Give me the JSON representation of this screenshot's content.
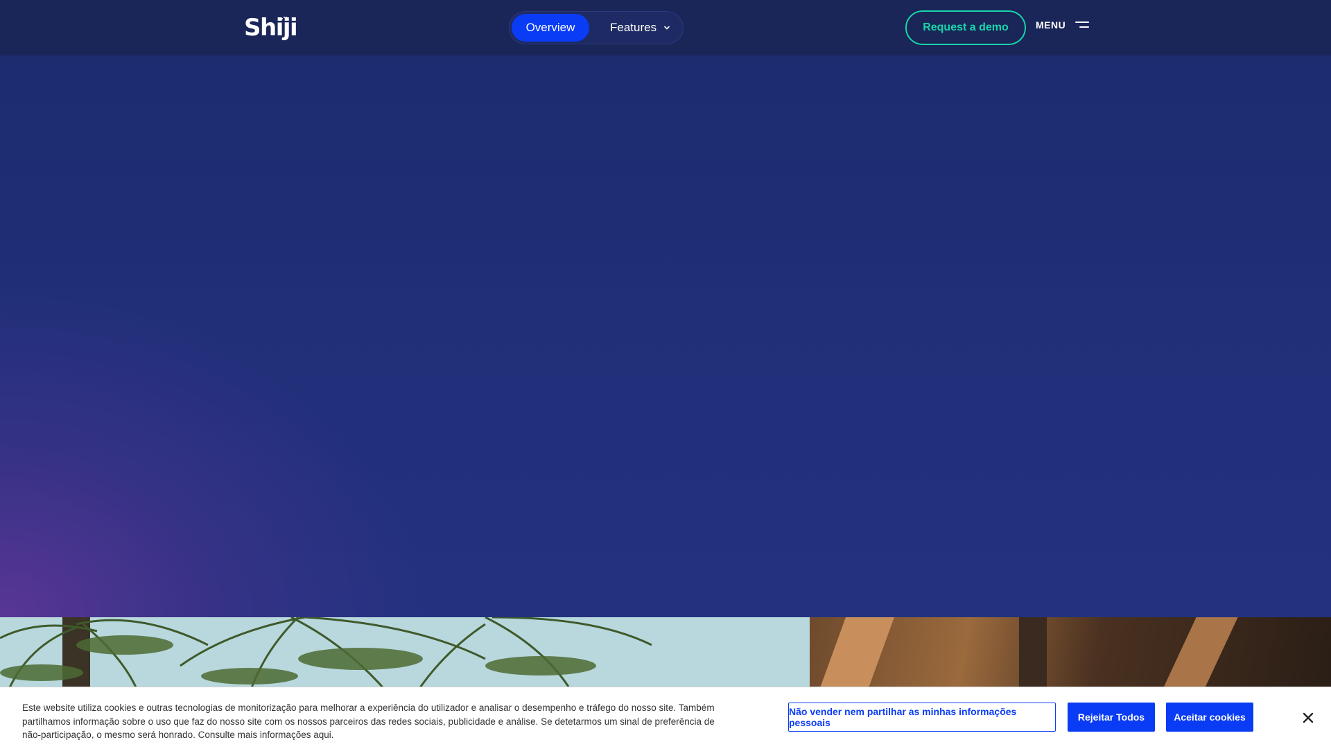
{
  "header": {
    "logo_text": "Shiji",
    "tabs": [
      {
        "label": "Overview",
        "active": true
      },
      {
        "label": "Features",
        "active": false
      }
    ],
    "cta_label": "Request a demo",
    "menu_label": "MENU"
  },
  "colors": {
    "header_bg": "#1a2558",
    "accent_blue": "#0a3cf5",
    "accent_teal": "#18d6a8",
    "hero_base": "#1f2f78",
    "hero_purple": "#5c3696"
  },
  "icons": {
    "features_dropdown": "chevron-down-icon",
    "menu": "hamburger-icon",
    "cookie_close": "close-icon"
  },
  "cookie_banner": {
    "text": "Este website utiliza cookies e outras tecnologias de monitorização para melhorar a experiência do utilizador e analisar o desempenho e tráfego do nosso site. Também partilhamos informação sobre o uso que faz do nosso site com os nossos parceiros das redes sociais, publicidade e análise. Se detetarmos um sinal de preferência de não-participação, o mesmo será honrado. Consulte mais informações aqui.",
    "opt_out_label": "Não vender nem partilhar as minhas informações pessoais",
    "reject_label": "Rejeitar Todos",
    "accept_label": "Aceitar cookies"
  }
}
